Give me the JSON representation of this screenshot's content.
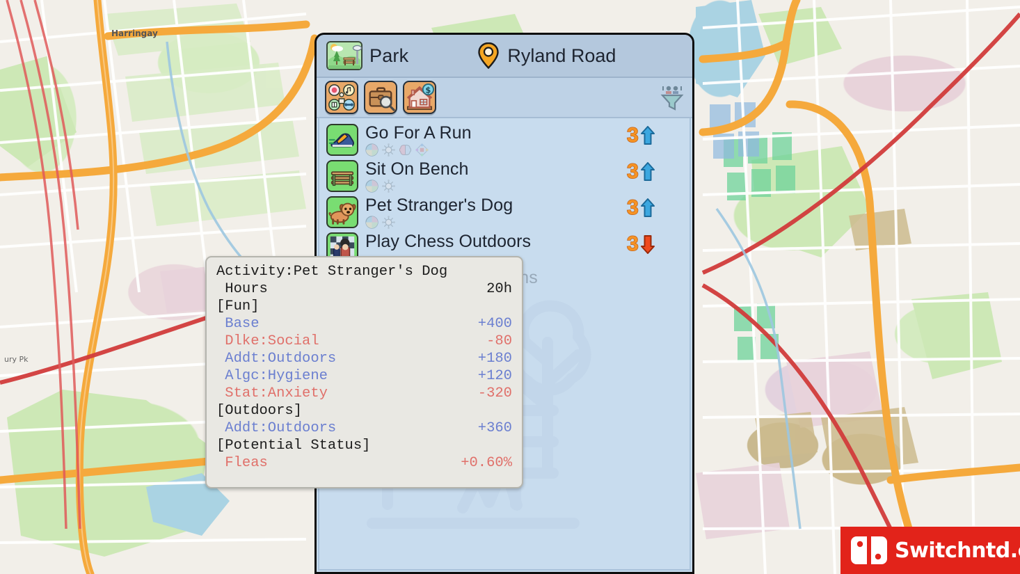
{
  "panel": {
    "location_name": "Park",
    "location_icon": "park-icon",
    "address": "Ryland Road",
    "address_icon": "map-pin-icon",
    "tabs": [
      {
        "id": "activities",
        "icon": "leisure-activities-icon",
        "label": "Activities"
      },
      {
        "id": "jobs",
        "icon": "briefcase-search-icon",
        "label": "Job Search"
      },
      {
        "id": "housing",
        "icon": "house-price-icon",
        "label": "Housing"
      }
    ],
    "filter_icon": "people-filter-icon",
    "activities": [
      {
        "name": "Go For A Run",
        "icon": "running-shoe-icon",
        "traits": [
          "mood-wheel-icon",
          "germ-icon",
          "brain-icon",
          "skill-diamond-icon"
        ],
        "score": "3",
        "trend": "up",
        "disabled": false
      },
      {
        "name": "Sit On Bench",
        "icon": "park-bench-icon",
        "traits": [
          "mood-wheel-icon",
          "germ-icon"
        ],
        "score": "3",
        "trend": "up",
        "disabled": false
      },
      {
        "name": "Pet Stranger's Dog",
        "icon": "dog-icon",
        "traits": [
          "mood-wheel-icon",
          "germ-icon"
        ],
        "score": "3",
        "trend": "up",
        "disabled": false
      },
      {
        "name": "Play Chess Outdoors",
        "icon": "chess-player-icon",
        "traits": [],
        "score": "3",
        "trend": "down",
        "disabled": false
      },
      {
        "name": "Scavenge Trash Cans",
        "icon": "trash-can-icon",
        "traits": [],
        "score": "",
        "trend": "blocked",
        "disabled": true
      }
    ],
    "watermark_icon": "park-bench-tree-watermark"
  },
  "tooltip": {
    "title_label": "Activity:",
    "title_value": "Pet Stranger's Dog",
    "rows": [
      {
        "type": "title",
        "label": "Activity:Pet Stranger's Dog",
        "value": "",
        "tone": "neutral"
      },
      {
        "type": "stat",
        "label": " Hours",
        "value": "20h",
        "tone": "neutral"
      },
      {
        "type": "section",
        "label": "[Fun]",
        "value": "",
        "tone": "neutral"
      },
      {
        "type": "stat",
        "label": " Base",
        "value": "+400",
        "tone": "pos"
      },
      {
        "type": "stat",
        "label": " Dlke:Social",
        "value": "-80",
        "tone": "neg"
      },
      {
        "type": "stat",
        "label": " Addt:Outdoors",
        "value": "+180",
        "tone": "pos"
      },
      {
        "type": "stat",
        "label": " Algc:Hygiene",
        "value": "+120",
        "tone": "pos"
      },
      {
        "type": "stat",
        "label": " Stat:Anxiety",
        "value": "-320",
        "tone": "neg"
      },
      {
        "type": "section",
        "label": "[Outdoors]",
        "value": "",
        "tone": "neutral"
      },
      {
        "type": "stat",
        "label": " Addt:Outdoors",
        "value": "+360",
        "tone": "pos"
      },
      {
        "type": "section",
        "label": "[Potential Status]",
        "value": "",
        "tone": "neutral"
      },
      {
        "type": "stat",
        "label": " Fleas",
        "value": "+0.60%",
        "tone": "neg"
      }
    ]
  },
  "watermark": {
    "logo_text": "Switchntd.com",
    "logo_icon": "nintendo-switch-icon"
  },
  "map": {
    "label": "Harringay"
  },
  "colors": {
    "panel_body": "#c8dcee",
    "panel_header": "#b4c8dd",
    "tab_bg": "#e8a868",
    "thumb_bg": "#79dd72",
    "score_orange": "#f59324",
    "arrow_up": "#3ba7e0",
    "arrow_down": "#ef4a1e",
    "blocked_x": "#ef4a3a",
    "tooltip_bg": "#e9e8e3",
    "tooltip_pos": "#6b7fd0",
    "tooltip_neg": "#e0706a",
    "logo_red": "#e2231a",
    "map_road": "#f5a93c",
    "map_rail": "#d13b3b",
    "map_green": "#cde8b6",
    "map_water": "#aad3e3"
  }
}
